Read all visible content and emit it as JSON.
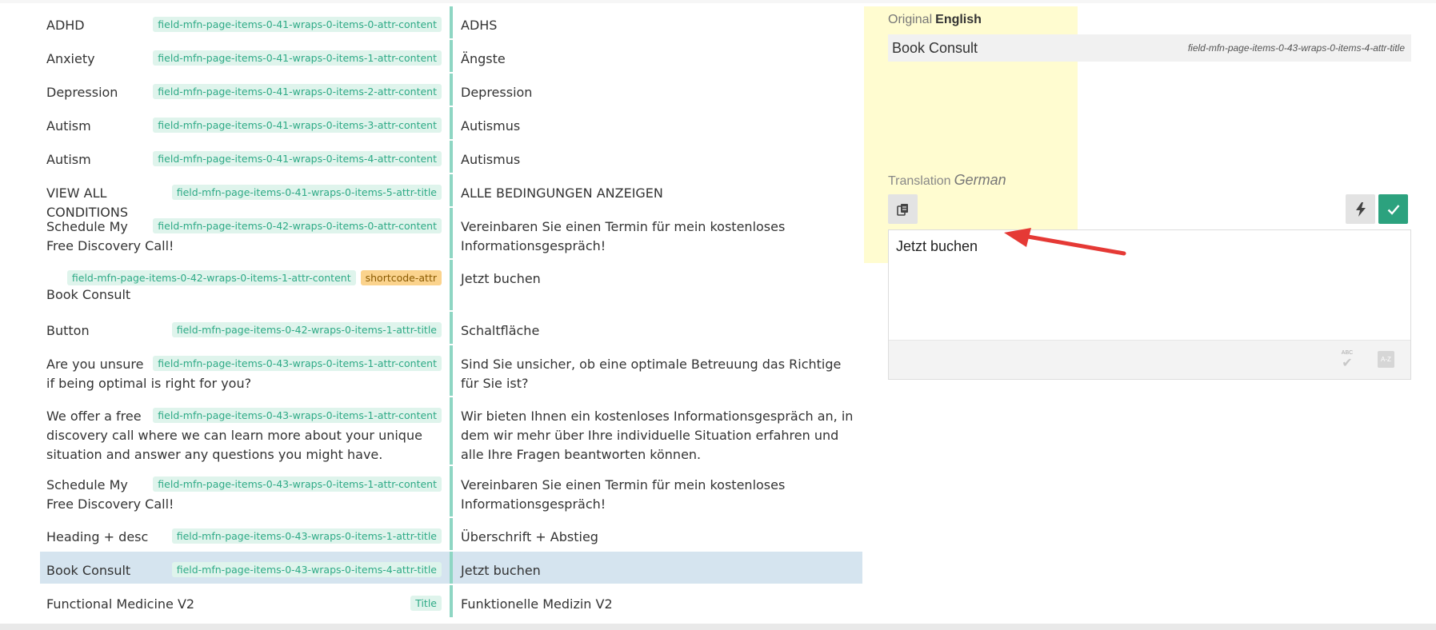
{
  "rows": [
    {
      "source": "ADHD",
      "tags": [
        "field-mfn-page-items-0-41-wraps-0-items-0-attr-content"
      ],
      "translation": "ADHS"
    },
    {
      "source": "Anxiety",
      "tags": [
        "field-mfn-page-items-0-41-wraps-0-items-1-attr-content"
      ],
      "translation": "Ängste"
    },
    {
      "source": "Depression",
      "tags": [
        "field-mfn-page-items-0-41-wraps-0-items-2-attr-content"
      ],
      "translation": "Depression"
    },
    {
      "source": "Autism",
      "tags": [
        "field-mfn-page-items-0-41-wraps-0-items-3-attr-content"
      ],
      "translation": "Autismus"
    },
    {
      "source": "Autism",
      "tags": [
        "field-mfn-page-items-0-41-wraps-0-items-4-attr-content"
      ],
      "translation": "Autismus"
    },
    {
      "source": "VIEW ALL CONDITIONS",
      "tags": [
        "field-mfn-page-items-0-41-wraps-0-items-5-attr-title"
      ],
      "translation": "ALLE BEDINGUNGEN ANZEIGEN"
    },
    {
      "source": "Schedule My Free Discovery Call!",
      "tags": [
        "field-mfn-page-items-0-42-wraps-0-items-0-attr-content"
      ],
      "translation": "Vereinbaren Sie einen Termin für mein kostenloses Informationsgespräch!"
    },
    {
      "source": "Book Consult",
      "tags": [
        "field-mfn-page-items-0-42-wraps-0-items-1-attr-content",
        "shortcode-attr"
      ],
      "translation": "Jetzt buchen"
    },
    {
      "source": "Button",
      "tags": [
        "field-mfn-page-items-0-42-wraps-0-items-1-attr-title"
      ],
      "translation": "Schaltfläche"
    },
    {
      "source": "Are you unsure if being optimal is right for you?",
      "tags": [
        "field-mfn-page-items-0-43-wraps-0-items-1-attr-content"
      ],
      "translation": "Sind Sie unsicher, ob eine optimale Betreuung das Richtige für Sie ist?"
    },
    {
      "source": "We offer a free discovery call where we can learn more about your unique situation and answer any questions you might have.",
      "tags": [
        "field-mfn-page-items-0-43-wraps-0-items-1-attr-content"
      ],
      "translation": "Wir bieten Ihnen ein kostenloses Informationsgespräch an, in dem wir mehr über Ihre individuelle Situation erfahren und alle Ihre Fragen beantworten können."
    },
    {
      "source": "Schedule My Free Discovery Call!",
      "tags": [
        "field-mfn-page-items-0-43-wraps-0-items-1-attr-content"
      ],
      "translation": "Vereinbaren Sie einen Termin für mein kostenloses Informationsgespräch!"
    },
    {
      "source": "Heading + desc",
      "tags": [
        "field-mfn-page-items-0-43-wraps-0-items-1-attr-title"
      ],
      "translation": "Überschrift + Abstieg"
    },
    {
      "source": "Book Consult",
      "tags": [
        "field-mfn-page-items-0-43-wraps-0-items-4-attr-title"
      ],
      "translation": "Jetzt buchen",
      "selected": true
    },
    {
      "source": "Functional Medicine V2",
      "tags": [
        "Title"
      ],
      "translation": "Funktionelle Medizin V2"
    }
  ],
  "editor": {
    "original_label": "Original",
    "original_lang": "English",
    "original_text": "Book Consult",
    "original_key": "field-mfn-page-items-0-43-wraps-0-items-4-attr-title",
    "translation_label": "Translation",
    "translation_lang": "German",
    "translation_value": "Jetzt buchen",
    "spell_label": "ABC",
    "dict_label": "A-Z"
  },
  "colors": {
    "accent": "#2ca27e",
    "tag_bg": "#dff4ec",
    "tag_text": "#2eaa86",
    "selected_row": "#d5e4ef",
    "highlight": "#fff9aa",
    "arrow": "#e53935"
  },
  "icons": {
    "copy": "copy-icon",
    "flash": "lightning-icon",
    "ok": "checkmark-icon",
    "spell": "spellcheck-icon",
    "dict": "dictionary-icon"
  }
}
